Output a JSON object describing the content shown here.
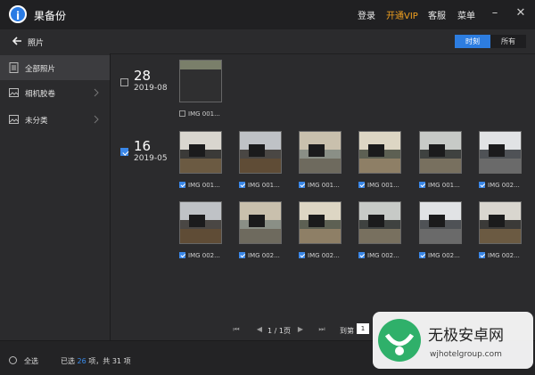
{
  "app": {
    "title": "果备份",
    "logo_glyph": "i"
  },
  "top_menu": {
    "login": "登录",
    "vip": "开通VIP",
    "service": "客服",
    "menu": "菜单"
  },
  "header": {
    "breadcrumb": "照片",
    "seg_time": "时刻",
    "seg_all": "所有"
  },
  "sidebar": {
    "items": [
      {
        "label": "全部照片",
        "icon": "document-icon"
      },
      {
        "label": "相机胶卷",
        "icon": "image-icon"
      },
      {
        "label": "未分类",
        "icon": "image-icon"
      }
    ]
  },
  "groups": [
    {
      "day": "28",
      "ym": "2019-08",
      "checked": false
    },
    {
      "day": "16",
      "ym": "2019-05",
      "checked": true
    }
  ],
  "photos_group1": [
    {
      "label": "IMG 001...",
      "checked": false
    }
  ],
  "photos_group2": [
    {
      "label": "IMG 001...",
      "checked": true
    },
    {
      "label": "IMG 001...",
      "checked": true
    },
    {
      "label": "IMG 001...",
      "checked": true
    },
    {
      "label": "IMG 001...",
      "checked": true
    },
    {
      "label": "IMG 001...",
      "checked": true
    },
    {
      "label": "IMG 002...",
      "checked": true
    },
    {
      "label": "IMG 002...",
      "checked": true
    },
    {
      "label": "IMG 002...",
      "checked": true
    },
    {
      "label": "IMG 002...",
      "checked": true
    },
    {
      "label": "IMG 002...",
      "checked": true
    },
    {
      "label": "IMG 002...",
      "checked": true
    },
    {
      "label": "IMG 002...",
      "checked": true
    }
  ],
  "pagination": {
    "page_info": "1 / 1页",
    "goto_label": "到第",
    "page_value": "1"
  },
  "status": {
    "all_label": "全选",
    "selected_prefix": "已选",
    "selected_count": "26",
    "selected_mid": "项，共",
    "total_count": "31",
    "selected_suffix": "项"
  },
  "watermark": {
    "brand": "无极安卓网",
    "url": "wjhotelgroup.com"
  },
  "colors": {
    "accent": "#2d7de0",
    "vip": "#f0a020",
    "count": "#3a8ef0"
  }
}
